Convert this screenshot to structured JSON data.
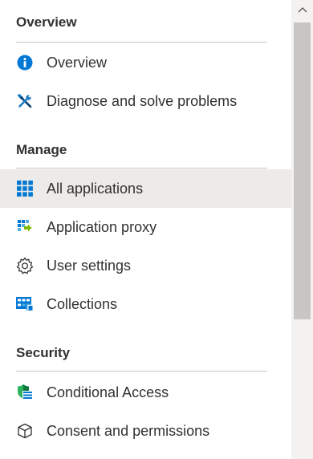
{
  "sections": {
    "overview": {
      "title": "Overview",
      "items": [
        {
          "label": "Overview",
          "icon": "info-icon"
        },
        {
          "label": "Diagnose and solve problems",
          "icon": "wrench-screwdriver-icon"
        }
      ]
    },
    "manage": {
      "title": "Manage",
      "items": [
        {
          "label": "All applications",
          "icon": "app-grid-icon",
          "selected": true
        },
        {
          "label": "Application proxy",
          "icon": "app-proxy-icon"
        },
        {
          "label": "User settings",
          "icon": "gear-icon"
        },
        {
          "label": "Collections",
          "icon": "collections-icon"
        }
      ]
    },
    "security": {
      "title": "Security",
      "items": [
        {
          "label": "Conditional Access",
          "icon": "conditional-access-icon"
        },
        {
          "label": "Consent and permissions",
          "icon": "cube-icon"
        }
      ]
    }
  },
  "colors": {
    "selected_background": "#edebe9",
    "text": "#323130",
    "divider": "#c8c6c4",
    "info_blue": "#0078d4",
    "scrollbar_track": "#f3f2f1",
    "scrollbar_thumb": "#c8c6c4"
  }
}
